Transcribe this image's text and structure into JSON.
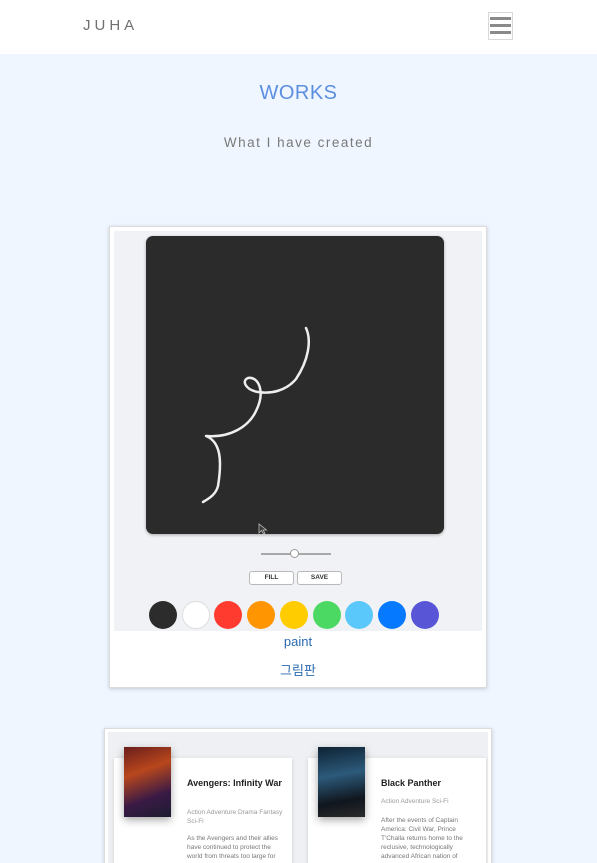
{
  "header": {
    "logo": "JUHA",
    "menu_icon": "hamburger-menu-icon"
  },
  "works": {
    "title": "WORKS",
    "subtitle": "What I have created"
  },
  "projects": [
    {
      "title": "paint",
      "subtitle": "그림판",
      "screenshot": {
        "buttons": [
          "FILL",
          "SAVE"
        ],
        "palette": [
          "#2c2c2c",
          "#ffffff",
          "#ff3b30",
          "#ff9500",
          "#ffcc00",
          "#4cd963",
          "#5ac8fa",
          "#0579ff",
          "#5856d6"
        ]
      }
    },
    {
      "movies": [
        {
          "title": "Avengers: Infinity War",
          "genres": "Action  Adventure  Drama  Fantasy  Sci-Fi",
          "description": "As the Avengers and their allies have continued to protect the world from threats too large for any one"
        },
        {
          "title": "Black Panther",
          "genres": "Action  Adventure  Sci-Fi",
          "description": "After the events of Captain America: Civil War, Prince T'Challa returns home to the reclusive, technologically advanced African nation of"
        }
      ]
    }
  ]
}
